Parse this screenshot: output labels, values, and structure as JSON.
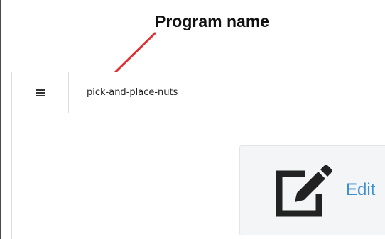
{
  "annotation": {
    "label": "Program name",
    "arrow_color": "#e03030"
  },
  "header": {
    "menu_icon": "hamburger-menu-icon",
    "program_name": "pick-and-place-nuts"
  },
  "card": {
    "icon": "edit-icon",
    "label": "Edit",
    "accent": "#3d8fd1"
  }
}
